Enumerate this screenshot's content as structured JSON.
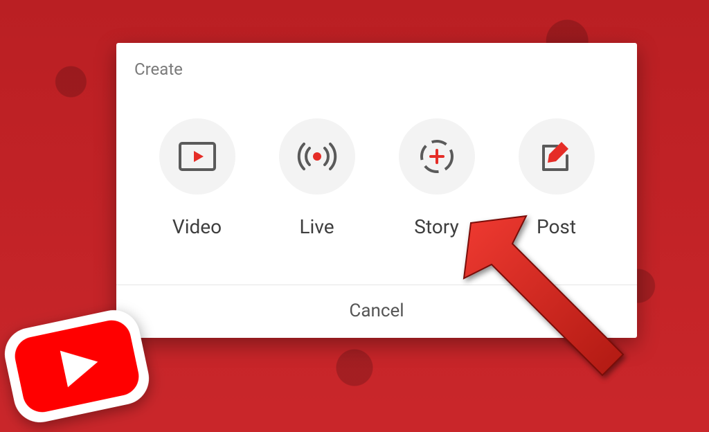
{
  "dialog": {
    "title": "Create",
    "options": [
      {
        "id": "video",
        "label": "Video"
      },
      {
        "id": "live",
        "label": "Live"
      },
      {
        "id": "story",
        "label": "Story"
      },
      {
        "id": "post",
        "label": "Post"
      }
    ],
    "cancel_label": "Cancel"
  },
  "colors": {
    "accent": "#e52d27",
    "icon_stroke": "#5a5a5a"
  }
}
